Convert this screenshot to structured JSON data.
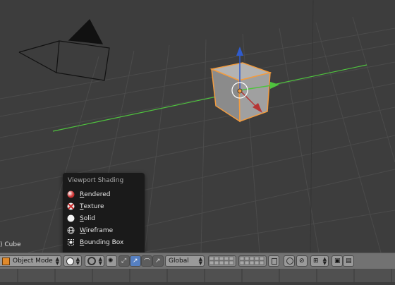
{
  "viewport": {
    "object_label": ") Cube"
  },
  "shading_menu": {
    "title": "Viewport Shading",
    "items": [
      {
        "first": "R",
        "rest": "endered",
        "icon": "rendered-sphere-icon"
      },
      {
        "first": "T",
        "rest": "exture",
        "icon": "texture-sphere-icon"
      },
      {
        "first": "S",
        "rest": "olid",
        "icon": "solid-sphere-icon"
      },
      {
        "first": "W",
        "rest": "ireframe",
        "icon": "wireframe-sphere-icon"
      },
      {
        "first": "B",
        "rest": "ounding Box",
        "icon": "bounding-box-icon"
      }
    ]
  },
  "header": {
    "mode": "Object Mode",
    "orientation": "Global"
  },
  "colors": {
    "viewport_bg": "#3d3d3d",
    "grid": "#4b4b4b",
    "x_axis": "#b63535",
    "y_axis": "#4fc33e",
    "z_axis": "#2f5bcc",
    "selection": "#f39c3f",
    "menu_bg": "#1a1a1a",
    "menu_highlight": "#5680c2",
    "header_bg": "#727272"
  }
}
